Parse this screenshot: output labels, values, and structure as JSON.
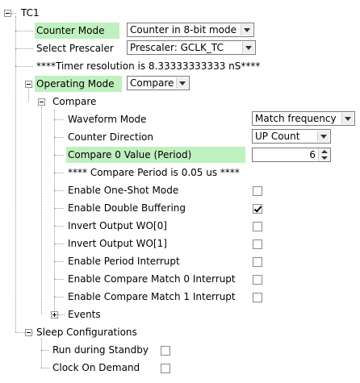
{
  "tree": {
    "root_label": "TC1",
    "counter_mode": {
      "label": "Counter Mode",
      "value": "Counter in 8-bit mode"
    },
    "select_prescaler": {
      "label": "Select Prescaler",
      "value": "Prescaler: GCLK_TC"
    },
    "timer_resolution_note": "****Timer resolution is 8.33333333333 nS****",
    "operating_mode": {
      "label": "Operating Mode",
      "value": "Compare"
    },
    "compare_group": {
      "label": "Compare",
      "waveform_mode": {
        "label": "Waveform Mode",
        "value": "Match frequency"
      },
      "counter_direction": {
        "label": "Counter Direction",
        "value": "UP Count"
      },
      "compare0_value": {
        "label": "Compare 0 Value (Period)",
        "value": "6"
      },
      "compare_period_note": "**** Compare Period is 0.05 us ****",
      "checkboxes": [
        {
          "label": "Enable One-Shot Mode",
          "checked": false
        },
        {
          "label": "Enable Double Buffering",
          "checked": true
        },
        {
          "label": "Invert Output WO[0]",
          "checked": false
        },
        {
          "label": "Invert Output WO[1]",
          "checked": false
        },
        {
          "label": "Enable Period Interrupt",
          "checked": false
        },
        {
          "label": "Enable Compare Match 0 Interrupt",
          "checked": false
        },
        {
          "label": "Enable Compare Match 1 Interrupt",
          "checked": false
        }
      ],
      "events_label": "Events"
    },
    "sleep_configurations": {
      "label": "Sleep Configurations",
      "run_during_standby": {
        "label": "Run during Standby",
        "checked": false
      },
      "clock_on_demand": {
        "label": "Clock On Demand",
        "checked": false
      }
    }
  },
  "colors": {
    "highlight": "#bff0bf",
    "tree_line": "#9a9a9a"
  }
}
